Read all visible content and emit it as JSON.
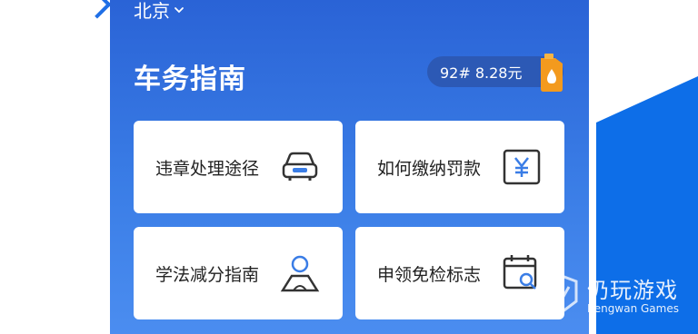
{
  "location": {
    "city": "北京"
  },
  "header": {
    "title": "车务指南",
    "fuel_price": "92# 8.28元"
  },
  "cards": [
    {
      "label": "违章处理途径",
      "icon": "car-icon"
    },
    {
      "label": "如何缴纳罚款",
      "icon": "yuan-icon"
    },
    {
      "label": "学法减分指南",
      "icon": "person-icon"
    },
    {
      "label": "申领免检标志",
      "icon": "calendar-search-icon"
    }
  ],
  "watermark": {
    "cn": "仍玩游戏",
    "en": "Rengwan Games"
  },
  "colors": {
    "accent": "#2a63d6",
    "card_icon": "#3a7de6",
    "fuel_icon": "#f39a1e"
  }
}
